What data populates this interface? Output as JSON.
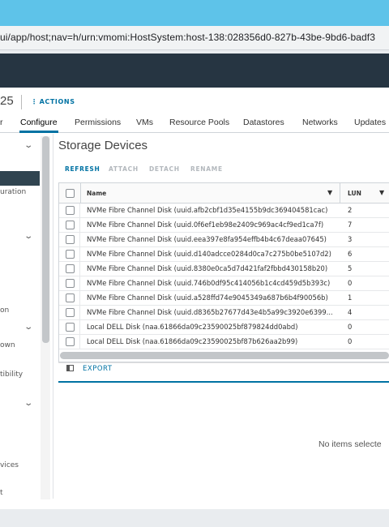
{
  "browser": {
    "url": "ui/app/host;nav=h/urn:vmomi:HostSystem:host-138:028356d0-827b-43be-9bd6-badf3"
  },
  "header": {
    "object_title": "25",
    "actions_label": "ACTIONS"
  },
  "tabs": [
    {
      "label": "r"
    },
    {
      "label": "Configure",
      "active": true
    },
    {
      "label": "Permissions"
    },
    {
      "label": "VMs"
    },
    {
      "label": "Resource Pools"
    },
    {
      "label": "Datastores"
    },
    {
      "label": "Networks"
    },
    {
      "label": "Updates"
    }
  ],
  "sidebar": {
    "items": [
      {
        "label": "uration"
      },
      {
        "label": "on"
      },
      {
        "label": "own"
      },
      {
        "label": "tibility"
      },
      {
        "label": "vices"
      },
      {
        "label": "t"
      }
    ]
  },
  "main": {
    "title": "Storage Devices",
    "toolbar": {
      "refresh": "REFRESH",
      "attach": "ATTACH",
      "detach": "DETACH",
      "rename": "RENAME"
    },
    "columns": {
      "name": "Name",
      "lun": "LUN"
    },
    "rows": [
      {
        "name": "NVMe Fibre Channel Disk (uuid.afb2cbf1d35e4155b9dc369404581cac)",
        "lun": "2"
      },
      {
        "name": "NVMe Fibre Channel Disk (uuid.0f6ef1eb98e2409c969ac4cf9ed1ca7f)",
        "lun": "7"
      },
      {
        "name": "NVMe Fibre Channel Disk (uuid.eea397e8fa954effb4b4c67deaa07645)",
        "lun": "3"
      },
      {
        "name": "NVMe Fibre Channel Disk (uuid.d140adcce0284d0ca7c275b0be5107d2)",
        "lun": "6"
      },
      {
        "name": "NVMe Fibre Channel Disk (uuid.8380e0ca5d7d421faf2fbbd430158b20)",
        "lun": "5"
      },
      {
        "name": "NVMe Fibre Channel Disk (uuid.746b0df95c414056b1c4cd459d5b393c)",
        "lun": "0"
      },
      {
        "name": "NVMe Fibre Channel Disk (uuid.a528ffd74e9045349a687b6b4f90056b)",
        "lun": "1"
      },
      {
        "name": "NVMe Fibre Channel Disk (uuid.d8365b27677d43e4b5a99c3920e6399...",
        "lun": "4"
      },
      {
        "name": "Local DELL Disk (naa.61866da09c23590025bf879824dd0abd)",
        "lun": "0"
      },
      {
        "name": "Local DELL Disk (naa.61866da09c23590025bf87b626aa2b99)",
        "lun": "0"
      }
    ],
    "export_label": "EXPORT",
    "detail_empty": "No items selecte"
  },
  "colors": {
    "titlebar": "#5ec3e9",
    "topnav": "#263542",
    "accent": "#0072a3"
  }
}
